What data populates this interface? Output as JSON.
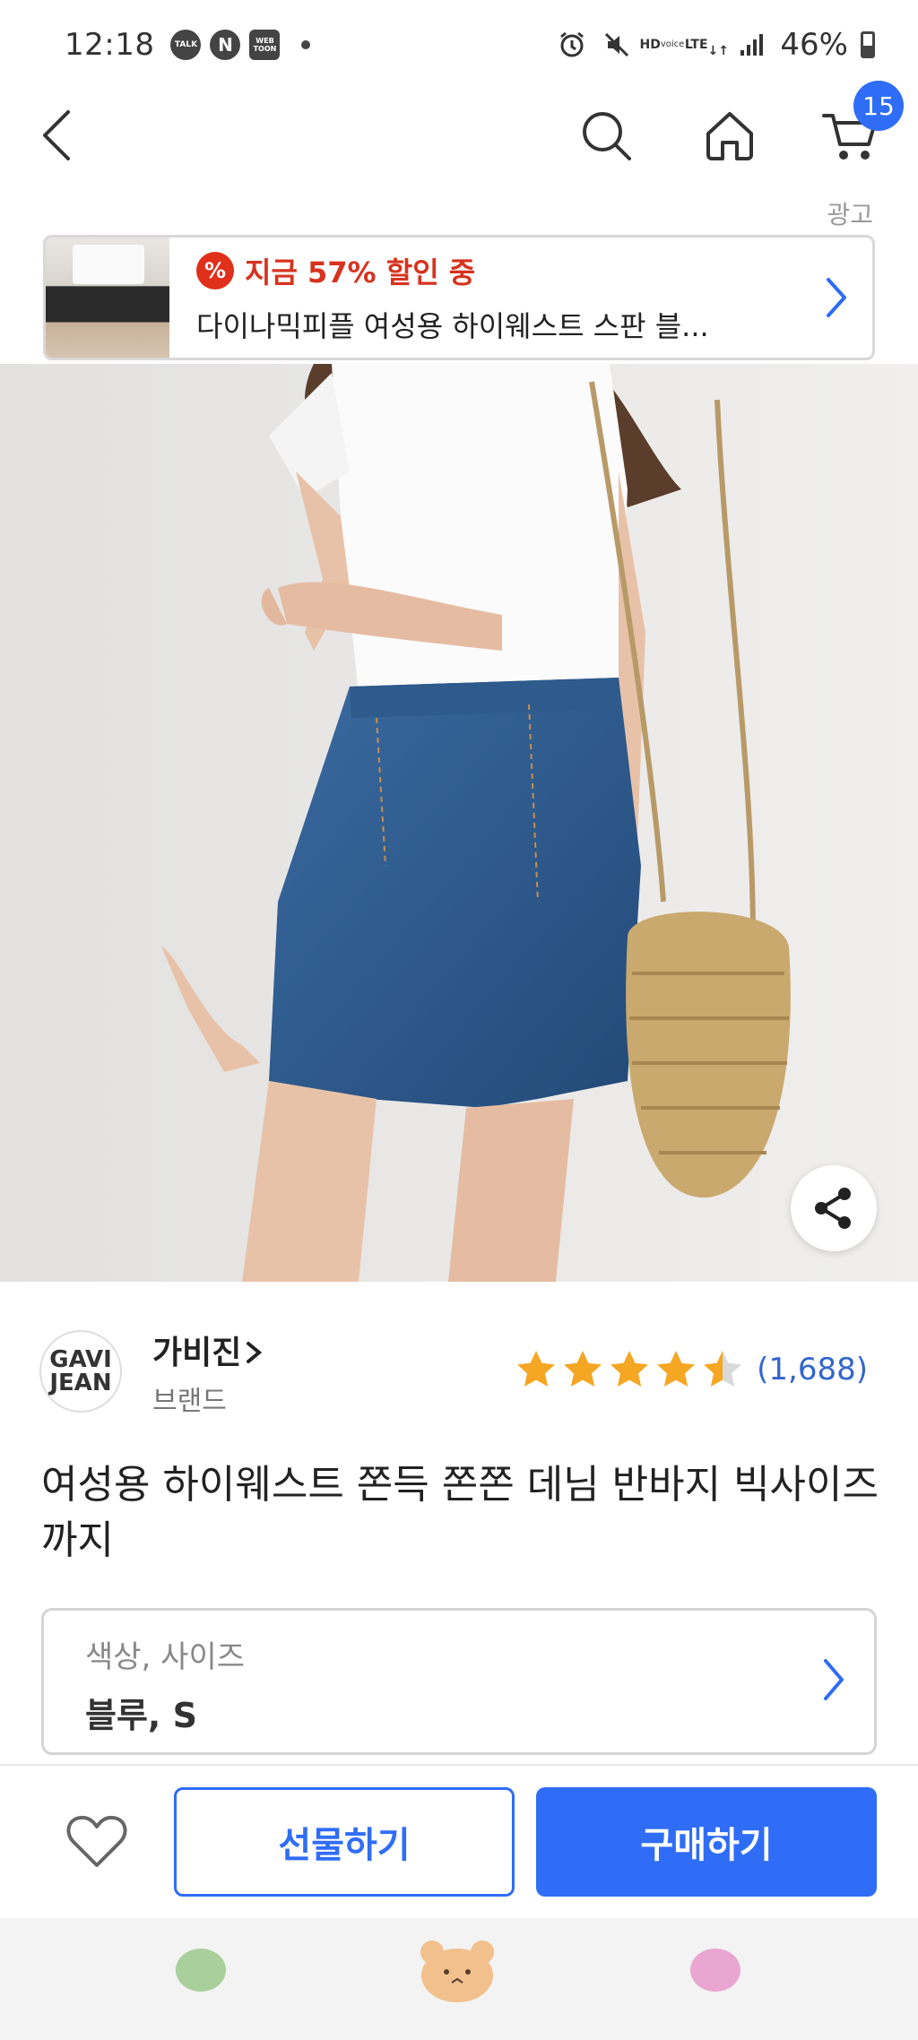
{
  "status_bar": {
    "time": "12:18",
    "app_icons": [
      "talk-icon",
      "naver-icon",
      "webtoon-icon"
    ],
    "talk_label": "TALK",
    "naver_label": "N",
    "webtoon_label": "WEB TOON",
    "hd_label": "HD",
    "voice_label": "voice",
    "lte_label": "LTE",
    "battery": "46%"
  },
  "nav": {
    "cart_count": "15"
  },
  "ad": {
    "label": "광고",
    "pct_symbol": "%",
    "discount_text": "지금 57% 할인 중",
    "product_text": "다이나믹피플 여성용 하이웨스트 스판 블..."
  },
  "brand": {
    "logo_line1": "GAVI",
    "logo_line2": "JEAN",
    "name": "가비진",
    "sub": "브랜드"
  },
  "rating": {
    "score": 4.5,
    "review_count": "(1,688)"
  },
  "product": {
    "title": "여성용 하이웨스트 쫀득 쫀쫀 데님 반바지 빅사이즈까지"
  },
  "option": {
    "label": "색상, 사이즈",
    "value": "블루, S"
  },
  "actions": {
    "gift_label": "선물하기",
    "buy_label": "구매하기"
  },
  "colors": {
    "accent": "#2f6df6",
    "discount_red": "#d6331f",
    "star": "#f5a623"
  }
}
